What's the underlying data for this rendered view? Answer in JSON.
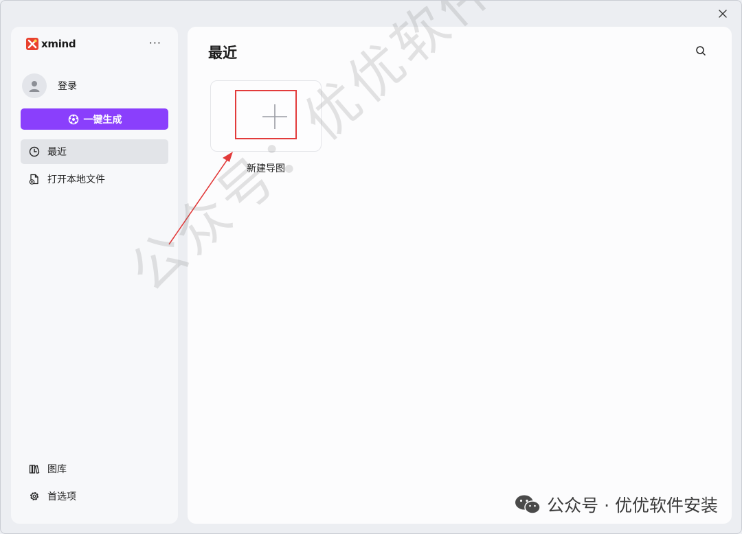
{
  "app": {
    "brand": "xmind",
    "more_label": "···"
  },
  "sidebar": {
    "login_label": "登录",
    "generate_label": "一键生成",
    "nav": [
      {
        "label": "最近",
        "active": true
      },
      {
        "label": "打开本地文件",
        "active": false
      }
    ],
    "bottom": [
      {
        "label": "图库"
      },
      {
        "label": "首选项"
      }
    ]
  },
  "main": {
    "title": "最近",
    "new_map_label": "新建导图"
  },
  "overlay": {
    "watermark": "公众号：优优软件安装",
    "footer": "公众号 · 优优软件安装"
  },
  "colors": {
    "accent": "#8a3ffc",
    "brand_red": "#e8412e",
    "highlight": "#e23b3b"
  }
}
